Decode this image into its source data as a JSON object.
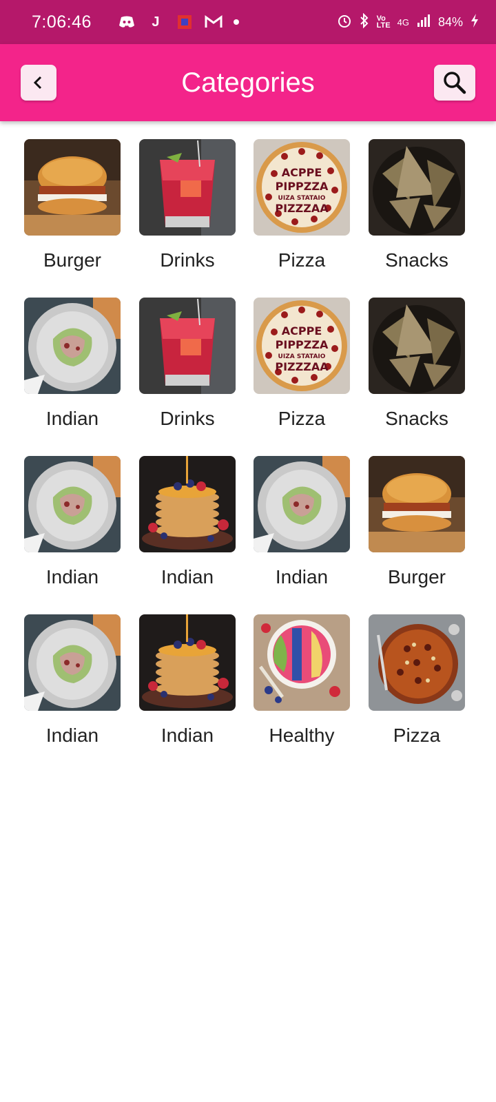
{
  "status_bar": {
    "time": "7:06:46",
    "battery": "84%",
    "network": "4G",
    "icons": [
      "discord-icon",
      "j-app-icon",
      "record-icon",
      "gmail-icon",
      "notification-dot-icon",
      "alarm-icon",
      "bluetooth-icon",
      "volte-icon",
      "signal-icon",
      "battery-charging-icon"
    ]
  },
  "app_bar": {
    "title": "Categories",
    "back_icon": "chevron-left-icon",
    "search_icon": "search-icon"
  },
  "colors": {
    "status_bar": "#b5186a",
    "app_bar": "#f3248a",
    "button_bg": "#fbe8f1"
  },
  "categories": [
    {
      "label": "Burger",
      "image": "burger"
    },
    {
      "label": "Drinks",
      "image": "drink"
    },
    {
      "label": "Pizza",
      "image": "pizza-text"
    },
    {
      "label": "Snacks",
      "image": "snacks"
    },
    {
      "label": "Indian",
      "image": "plate"
    },
    {
      "label": "Drinks",
      "image": "drink"
    },
    {
      "label": "Pizza",
      "image": "pizza-text"
    },
    {
      "label": "Snacks",
      "image": "snacks"
    },
    {
      "label": "Indian",
      "image": "plate"
    },
    {
      "label": "Indian",
      "image": "pancakes"
    },
    {
      "label": "Indian",
      "image": "plate"
    },
    {
      "label": "Burger",
      "image": "burger"
    },
    {
      "label": "Indian",
      "image": "plate"
    },
    {
      "label": "Indian",
      "image": "pancakes"
    },
    {
      "label": "Healthy",
      "image": "bowl"
    },
    {
      "label": "Pizza",
      "image": "pizza"
    }
  ]
}
